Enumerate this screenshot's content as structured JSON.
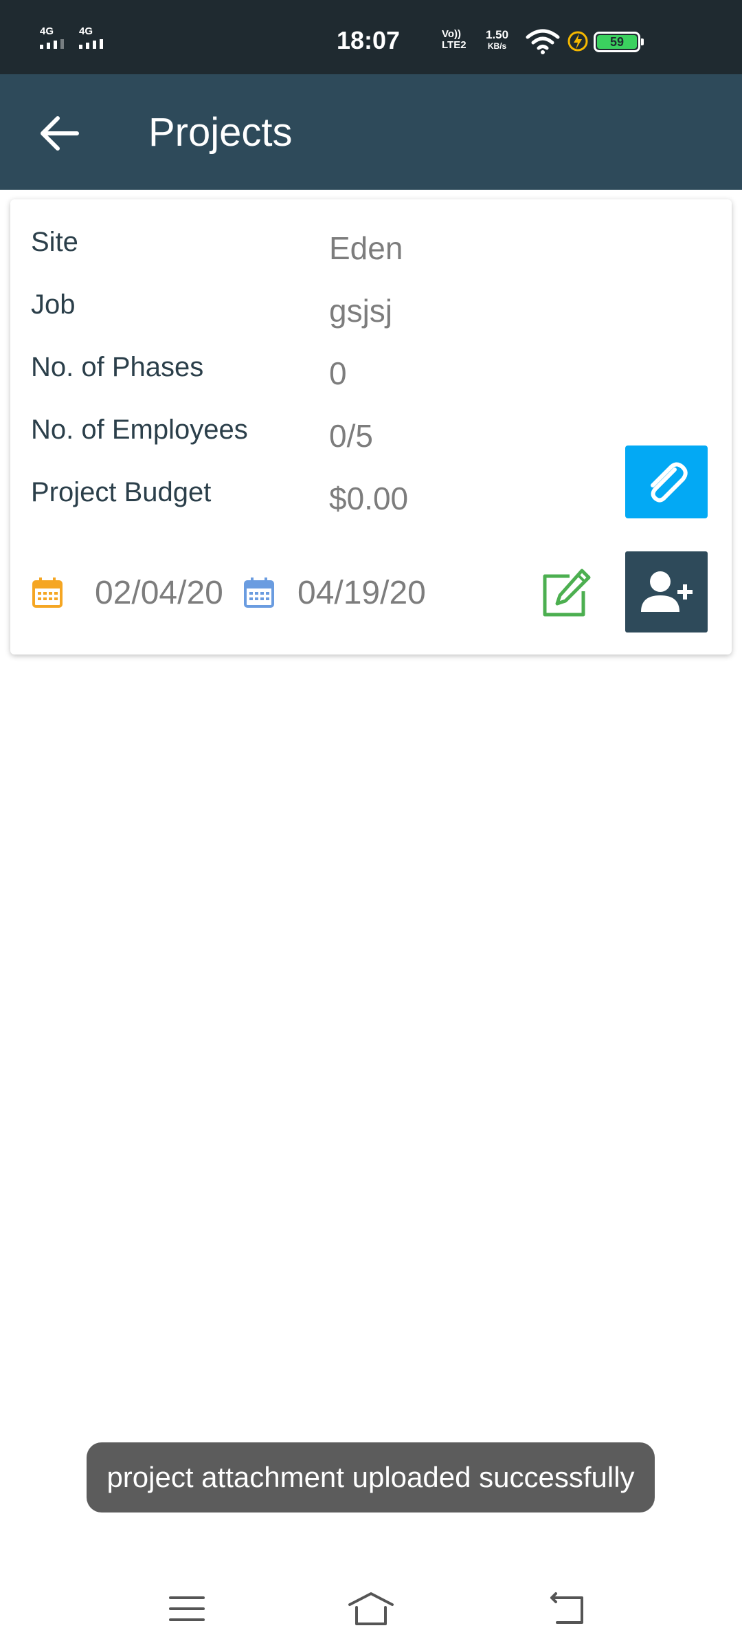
{
  "status_bar": {
    "network1": "4G",
    "network2": "4G",
    "time": "18:07",
    "volte_top": "Vo))",
    "volte_bottom": "LTE2",
    "speed_value": "1.50",
    "speed_unit": "KB/s",
    "battery": "59",
    "icons": [
      "signal-icon",
      "wifi-icon",
      "charging-bolt-icon",
      "battery-icon"
    ]
  },
  "app_bar": {
    "title": "Projects",
    "back_icon": "arrow-left-icon"
  },
  "project": {
    "fields": [
      {
        "label": "Site",
        "value": "Eden"
      },
      {
        "label": "Job",
        "value": "gsjsj"
      },
      {
        "label": "No. of Phases",
        "value": "0"
      },
      {
        "label": "No. of Employees",
        "value": "0/5"
      },
      {
        "label": "Project Budget",
        "value": "$0.00"
      }
    ],
    "start_date": "02/04/20",
    "end_date": "04/19/20",
    "actions": {
      "attach_icon": "paperclip-icon",
      "edit_icon": "edit-icon",
      "add_user_icon": "add-user-icon"
    }
  },
  "toast": {
    "message": "project attachment uploaded successfully"
  },
  "nav_bar": {
    "icons": [
      "menu-icon",
      "home-icon",
      "back-icon"
    ]
  },
  "colors": {
    "status_bar": "#1f2a30",
    "app_bar": "#2e4a5a",
    "attach_button": "#03a9f4",
    "edit_icon": "#4caf50",
    "start_calendar": "#f5a623",
    "end_calendar": "#6a9ce0",
    "toast_bg": "#5c5c5c"
  }
}
